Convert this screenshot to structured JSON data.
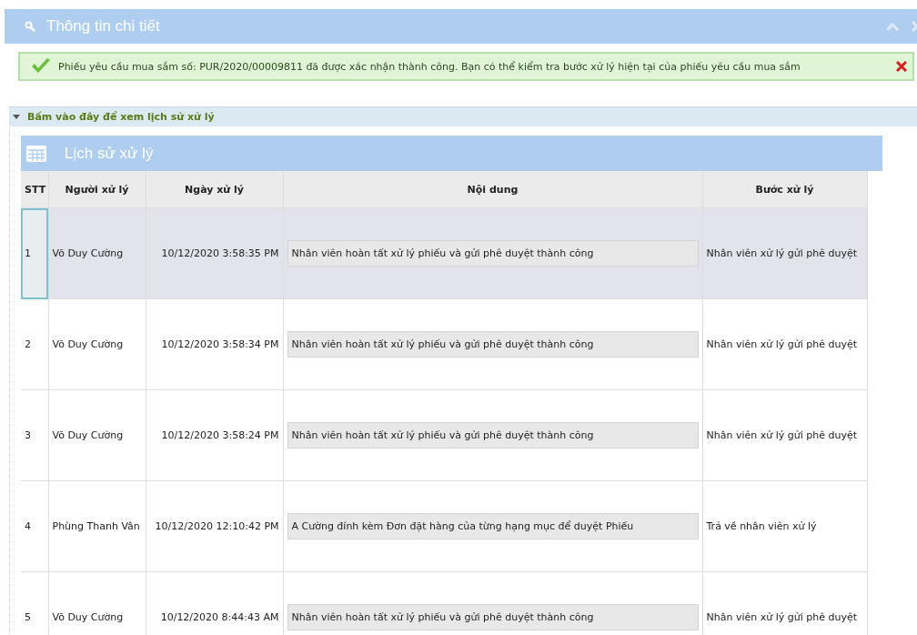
{
  "panel": {
    "title": "Thông tin chi tiết"
  },
  "alert": {
    "message": "Phiếu yêu cầu mua sắm số: PUR/2020/00009811 đã được xác nhận thành công. Bạn có thể kiểm tra bước xử lý hiện tại của phiếu yêu cầu mua sắm"
  },
  "history_toggle": {
    "label": "Bấm vào đây để xem lịch sử xử lý",
    "expanded": true
  },
  "table": {
    "title": "Lịch sử xử lý",
    "columns": [
      "STT",
      "Người xử lý",
      "Ngày xử lý",
      "Nội dung",
      "Bước xử lý"
    ],
    "rows": [
      {
        "stt": "1",
        "person": "Võ Duy Cường",
        "date": "10/12/2020 3:58:35 PM",
        "content": "Nhân viên hoàn tất xử lý phiếu và gửi phê duyệt thành công",
        "step": "Nhân viên xử lý gửi phê duyệt",
        "selected": true
      },
      {
        "stt": "2",
        "person": "Võ Duy Cường",
        "date": "10/12/2020 3:58:34 PM",
        "content": "Nhân viên hoàn tất xử lý phiếu và gửi phê duyệt thành công",
        "step": "Nhân viên xử lý gửi phê duyệt",
        "selected": false
      },
      {
        "stt": "3",
        "person": "Võ Duy Cường",
        "date": "10/12/2020 3:58:24 PM",
        "content": "Nhân viên hoàn tất xử lý phiếu và gửi phê duyệt thành công",
        "step": "Nhân viên xử lý gửi phê duyệt",
        "selected": false
      },
      {
        "stt": "4",
        "person": "Phùng Thanh Vân",
        "date": "10/12/2020 12:10:42 PM",
        "content": "A Cường đính kèm Đơn đặt hàng của từng hạng mục để duyệt Phiếu",
        "step": "Trả về nhân viên xử lý",
        "selected": false
      },
      {
        "stt": "5",
        "person": "Võ Duy Cường",
        "date": "10/12/2020 8:44:43 AM",
        "content": "Nhân viên hoàn tất xử lý phiếu và gửi phê duyệt thành công",
        "step": "Nhân viên xử lý gửi phê duyệt",
        "selected": false
      }
    ]
  }
}
